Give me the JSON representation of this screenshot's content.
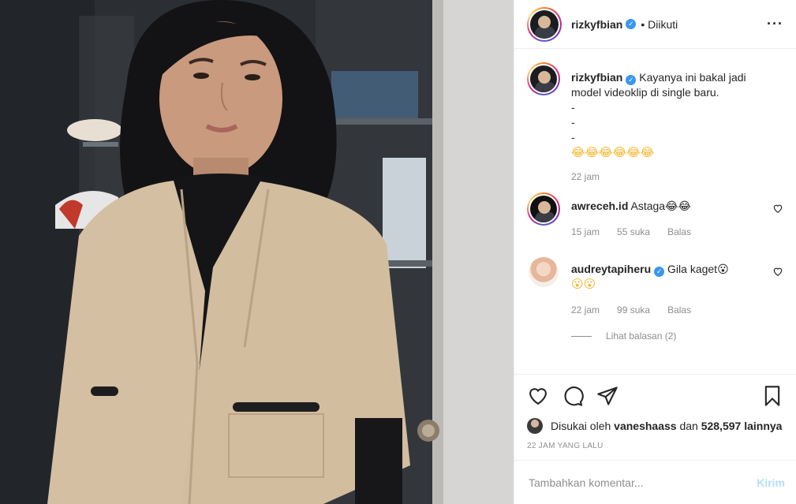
{
  "post": {
    "author": "rizkyfbian",
    "follow_state": "• Diikuti",
    "more_icon": "more-options-icon",
    "caption": {
      "username": "rizkyfbian",
      "lines": [
        "Kayanya ini bakal jadi",
        "model videoklip di single baru.",
        "-",
        "-",
        "-"
      ],
      "emojis": "😂😂😂😂😂😂",
      "age": "22 jam"
    },
    "comments": [
      {
        "username": "awreceh.id",
        "text": "Astaga😂😂",
        "age": "15 jam",
        "likes": "55 suka",
        "reply": "Balas"
      },
      {
        "username": "audreytapiheru",
        "text": "Gila kaget😮",
        "text2": "😮😮",
        "age": "22 jam",
        "likes": "99 suka",
        "reply": "Balas",
        "view_replies": "Lihat balasan (2)"
      }
    ],
    "likes_prefix": "Disukai oleh",
    "likes_user": "vaneshaass",
    "likes_and": "dan",
    "likes_count": "528,597",
    "likes_suffix": "lainnya",
    "timestamp": "22 JAM YANG LALU",
    "comment_placeholder": "Tambahkan komentar...",
    "post_button": "Kirim"
  },
  "colors": {
    "link_blue": "#3897f0",
    "disabled_blue": "#b2dffc",
    "muted": "#8e8e8e"
  }
}
